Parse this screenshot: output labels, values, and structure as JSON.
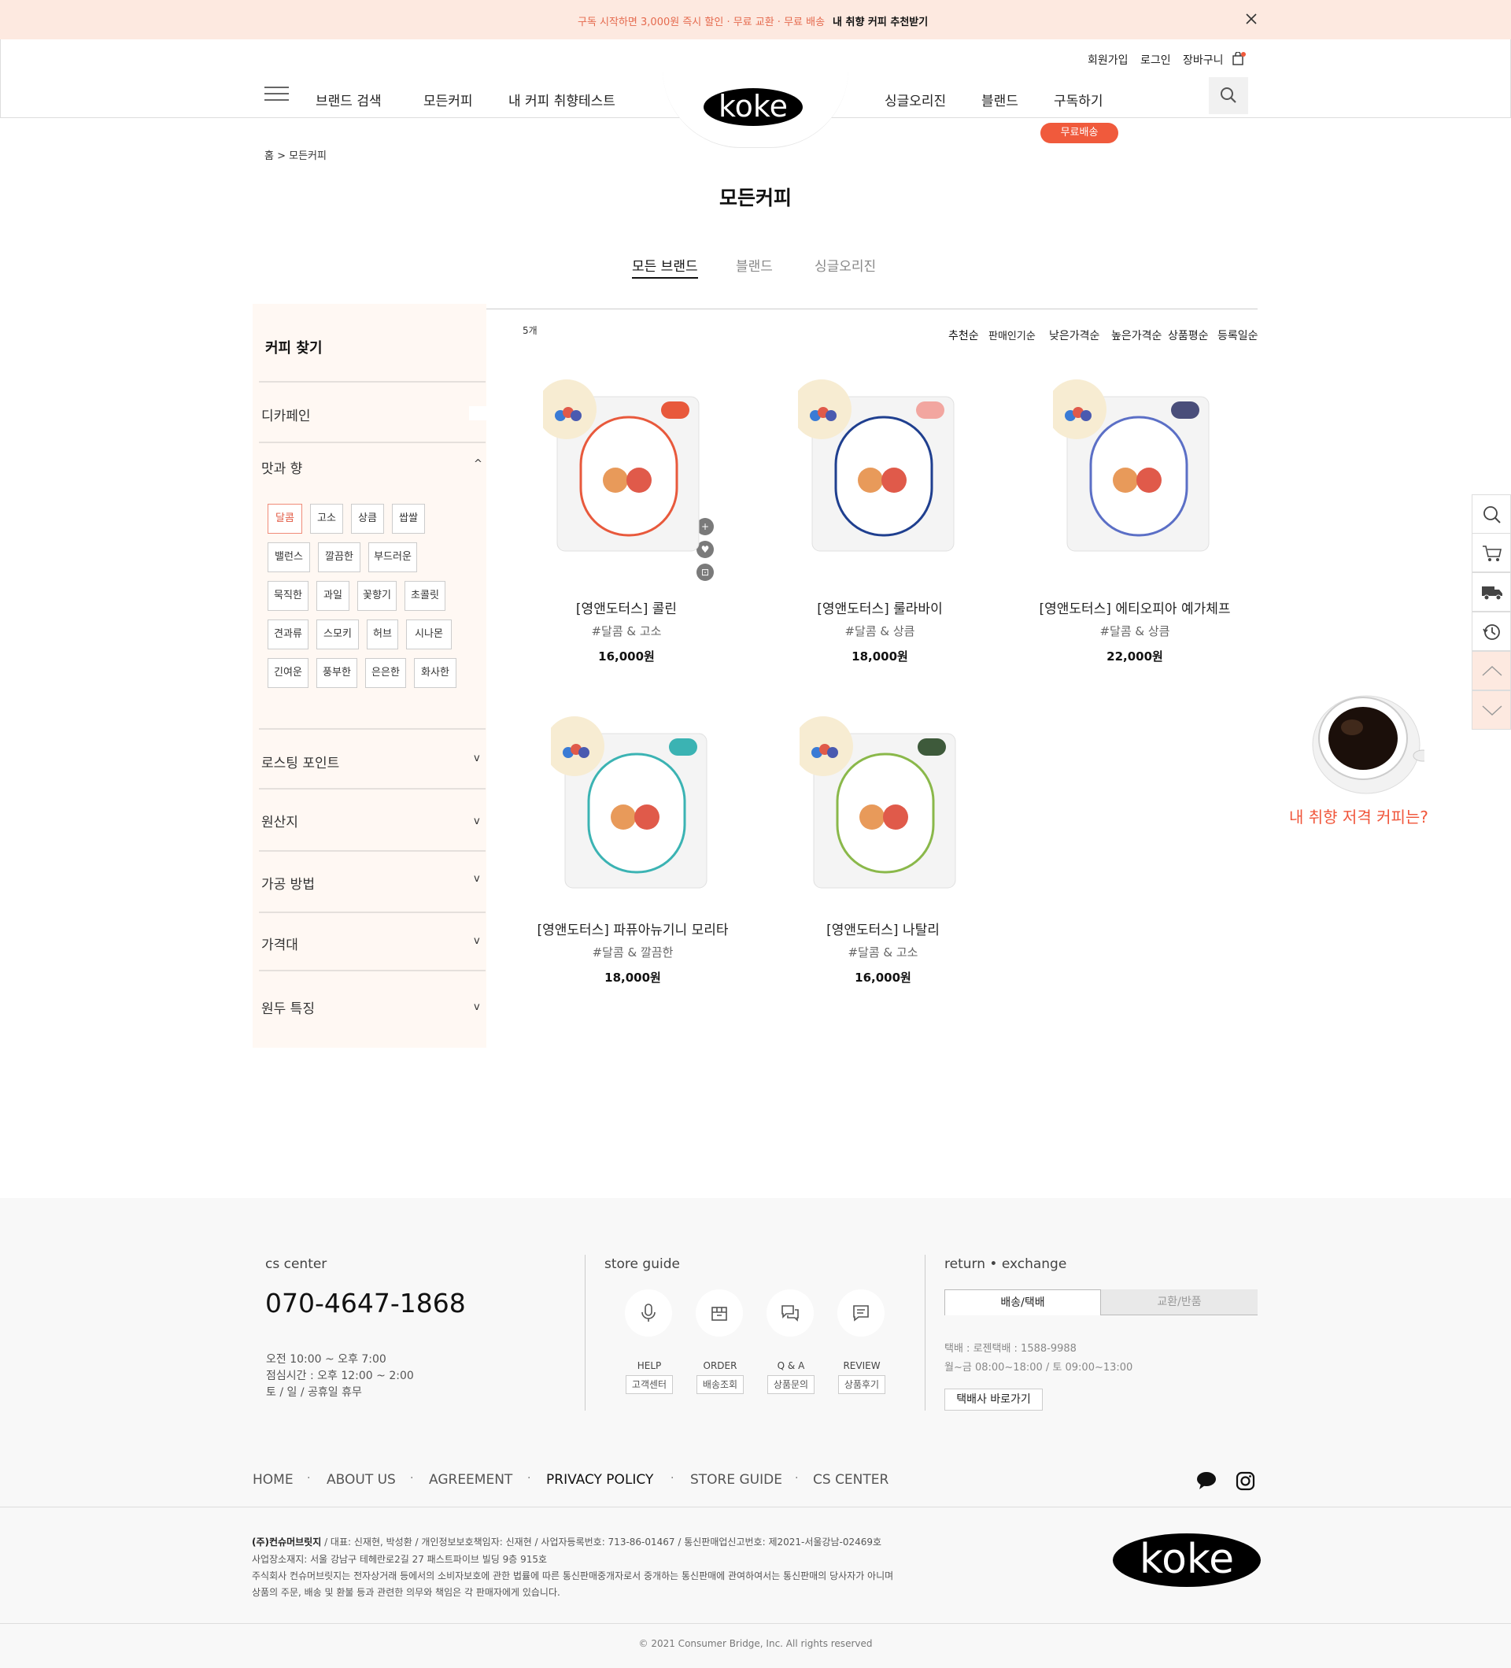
{
  "banner": {
    "promo": "구독 시작하면 3,000원 즉시 할인 · 무료 교환 · 무료 배송",
    "cta": "내 취향 커피 추천받기"
  },
  "header": {
    "util": [
      "회원가입",
      "로그인",
      "장바구니"
    ],
    "nav_left": [
      "브랜드 검색",
      "모든커피",
      "내 커피 취향테스트"
    ],
    "nav_right": [
      "싱글오리진",
      "블랜드",
      "구독하기"
    ],
    "logo": "koke",
    "free_badge": "무료배송"
  },
  "breadcrumb": "홈 > 모든커피",
  "page_title": "모든커피",
  "category_tabs": [
    "모든 브랜드",
    "블랜드",
    "싱글오리진"
  ],
  "sidebar": {
    "title": "커피 찾기",
    "sections": [
      "디카페인",
      "맛과 향",
      "로스팅 포인트",
      "원산지",
      "가공 방법",
      "가격대",
      "원두 특징"
    ],
    "tags": [
      [
        "달콤",
        "고소",
        "상큼",
        "쌉쌀"
      ],
      [
        "밸런스",
        "깔끔한",
        "부드러운"
      ],
      [
        "묵직한",
        "과일",
        "꽃향기",
        "초콜릿"
      ],
      [
        "견과류",
        "스모키",
        "허브",
        "시나몬"
      ],
      [
        "긴여운",
        "풍부한",
        "은은한",
        "화사한"
      ]
    ]
  },
  "listing": {
    "count": "5개",
    "sort": [
      "추천순",
      "판매인기순",
      "낮은가격순",
      "높은가격순",
      "상품평순",
      "등록일순"
    ]
  },
  "products": [
    {
      "name": "[영앤도터스] 콜린",
      "tags": "#달콤 & 고소",
      "price": "16,000원",
      "accent": "#e8593c",
      "tag_color": "#e8593c"
    },
    {
      "name": "[영앤도터스] 룰라바이",
      "tags": "#달콤 & 상큼",
      "price": "18,000원",
      "accent": "#f2a6a0",
      "tag_color": "#1f3f8f"
    },
    {
      "name": "[영앤도터스] 에티오피아 예가체프",
      "tags": "#달콤 & 상큼",
      "price": "22,000원",
      "accent": "#4a4e7a",
      "tag_color": "#5b6fc6"
    },
    {
      "name": "[영앤도터스] 파퓨아뉴기니 모리타",
      "tags": "#달콤 & 깔끔한",
      "price": "18,000원",
      "accent": "#3bb3b3",
      "tag_color": "#3bb3b3"
    },
    {
      "name": "[영앤도터스] 나탈리",
      "tags": "#달콤 & 고소",
      "price": "16,000원",
      "accent": "#3e5a3b",
      "tag_color": "#8ab84a"
    }
  ],
  "quick_panel_cta": "내 취향 저격 커피는?",
  "footer": {
    "cs_title": "cs center",
    "phone": "070-4647-1868",
    "hours": [
      "오전 10:00 ~ 오후 7:00",
      "점심시간 : 오후 12:00 ~ 2:00",
      "토 / 일 / 공휴일 휴무"
    ],
    "store_title": "store guide",
    "store_items": [
      {
        "en": "HELP",
        "ko": "고객센터"
      },
      {
        "en": "ORDER",
        "ko": "배송조회"
      },
      {
        "en": "Q & A",
        "ko": "상품문의"
      },
      {
        "en": "REVIEW",
        "ko": "상품후기"
      }
    ],
    "return_title": "return • exchange",
    "return_tabs": [
      "배송/택배",
      "교환/반품"
    ],
    "return_lines": [
      "택배 : 로젠택배 : 1588-9988",
      "월~금 08:00~18:00 / 토 09:00~13:00"
    ],
    "return_button": "택배사 바로가기",
    "links": [
      "HOME",
      "ABOUT US",
      "AGREEMENT",
      "PRIVACY POLICY",
      "STORE GUIDE",
      "CS CENTER"
    ],
    "company_name": "(주)컨슈머브릿지",
    "info": [
      " / 대표: 신재현, 박성환 / 개인정보보호책임자: 신재현 / 사업자등록번호: 713-86-01467 / 통신판매업신고번호: 제2021-서울강남-02469호",
      "사업장소재지: 서울 강남구 테헤란로2길 27 패스트파이브 빌딩 9층 915호",
      "주식회사 컨슈머브릿지는 전자상거래 등에서의 소비자보호에 관한 법률에 따른 통신판매중개자로서 중개하는 통신판매에 관여하여서는 통신판매의 당사자가 아니며",
      "상품의 주문, 배송 및 환불 등과 관련한 의무와 책임은 각 판매자에게 있습니다."
    ],
    "logo": "koke",
    "copyright": "© 2021 Consumer Bridge, Inc. All rights reserved"
  },
  "colors": {
    "accent": "#f05a3c",
    "banner_bg": "#fde9e0",
    "sidebar_bg": "#fff8f3"
  }
}
